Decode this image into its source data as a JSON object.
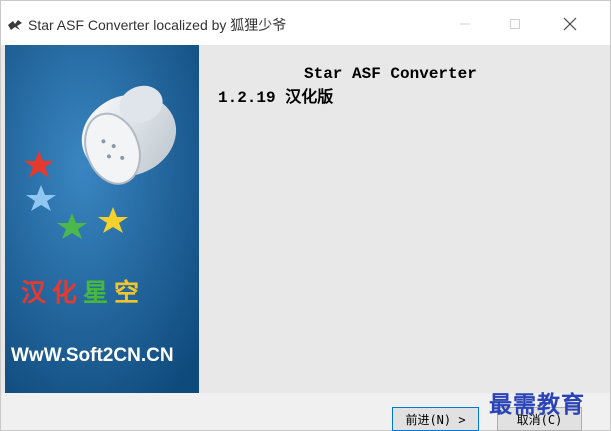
{
  "window": {
    "title": "Star ASF Converter localized by 狐狸少爷",
    "accent": "#1a5e92"
  },
  "banner": {
    "chars": [
      "汉",
      "化",
      "星",
      "空"
    ],
    "url": "WwW.Soft2CN.CN"
  },
  "main": {
    "app_name": "Star ASF Converter",
    "version": "1.2.19 汉化版"
  },
  "buttons": {
    "next": "前进(N) >",
    "cancel": "取消(C)"
  },
  "watermark": "最需教育"
}
